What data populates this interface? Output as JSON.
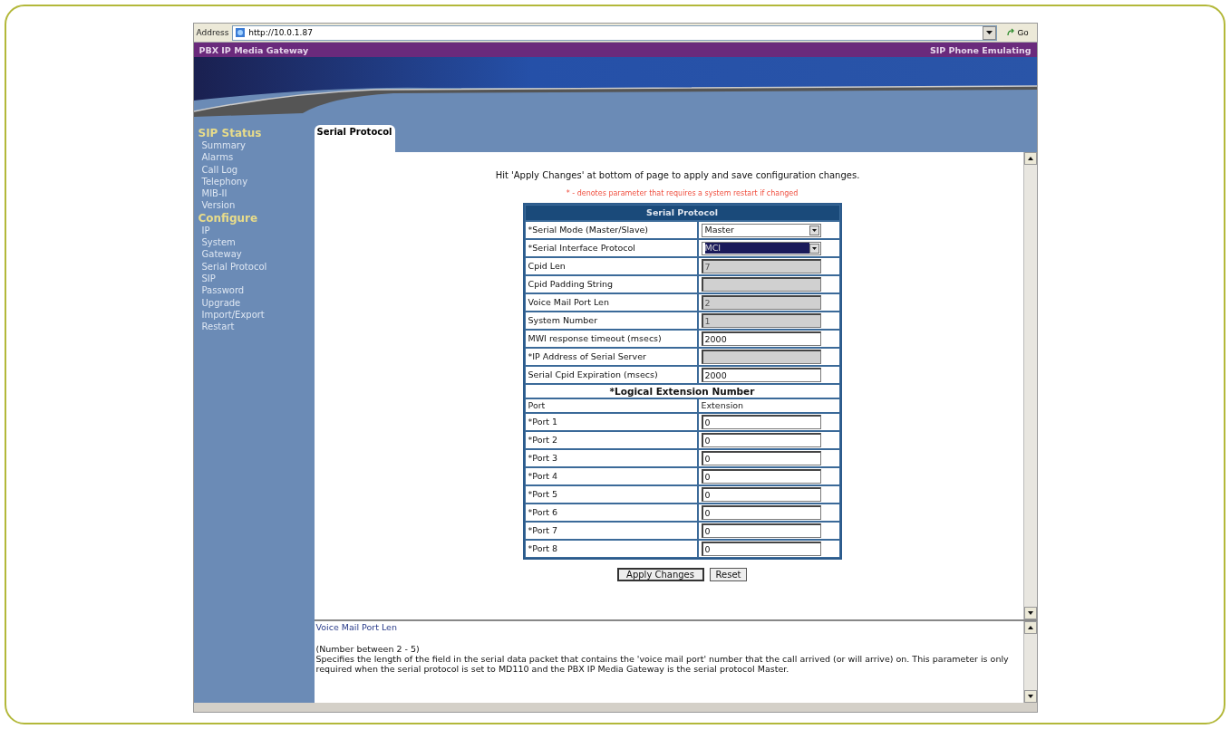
{
  "address_bar": {
    "label": "Address",
    "url": "http://10.0.1.87",
    "go": "Go"
  },
  "header": {
    "title": "PBX IP Media Gateway",
    "mode": "SIP Phone Emulating"
  },
  "sidebar": {
    "sections": [
      {
        "heading": "SIP Status",
        "items": [
          {
            "label": "Summary",
            "selected": false
          },
          {
            "label": "Alarms",
            "selected": false
          },
          {
            "label": "Call Log",
            "selected": false
          },
          {
            "label": "Telephony",
            "selected": false
          },
          {
            "label": "MIB-II",
            "selected": false
          },
          {
            "label": "Version",
            "selected": false
          }
        ]
      },
      {
        "heading": "Configure",
        "items": [
          {
            "label": "IP",
            "selected": false
          },
          {
            "label": "System",
            "selected": false
          },
          {
            "label": "Gateway",
            "selected": false
          },
          {
            "label": "Serial Protocol",
            "selected": false
          },
          {
            "label": "SIP",
            "selected": false
          },
          {
            "label": "Password",
            "selected": false
          },
          {
            "label": "Upgrade",
            "selected": false
          },
          {
            "label": "Import/Export",
            "selected": false
          },
          {
            "label": "Restart",
            "selected": false
          }
        ]
      }
    ]
  },
  "tabs": [
    {
      "label": "Serial Protocol",
      "selected": true
    }
  ],
  "instructions": "Hit 'Apply Changes' at bottom of page to apply and save configuration changes.",
  "note": "* - denotes parameter that requires a system restart if changed",
  "form": {
    "title": "Serial Protocol",
    "rows": [
      {
        "kind": "select",
        "label": "*Serial Mode (Master/Slave)",
        "value": "Master",
        "focused": false
      },
      {
        "kind": "select",
        "label": "*Serial Interface Protocol",
        "value": "MCI",
        "focused": true
      },
      {
        "kind": "input",
        "label": "Cpid Len",
        "value": "7",
        "disabled": true
      },
      {
        "kind": "input",
        "label": "Cpid Padding String",
        "disabled": true
      },
      {
        "kind": "input",
        "label": "Voice Mail Port Len",
        "value": "2",
        "disabled": true
      },
      {
        "kind": "input",
        "label": "System Number",
        "value": "1",
        "disabled": true
      },
      {
        "kind": "input",
        "label": "MWI response timeout (msecs)",
        "value": "2000",
        "disabled": false
      },
      {
        "kind": "input",
        "label": "*IP Address of Serial Server",
        "disabled": true
      },
      {
        "kind": "input",
        "label": "Serial Cpid Expiration (msecs)",
        "value": "2000",
        "disabled": false
      }
    ],
    "section": "*Logical Extension Number",
    "columns": [
      "Port",
      "Extension"
    ],
    "ports": [
      {
        "label": "*Port 1",
        "value": "0"
      },
      {
        "label": "*Port 2",
        "value": "0"
      },
      {
        "label": "*Port 3",
        "value": "0"
      },
      {
        "label": "*Port 4",
        "value": "0"
      },
      {
        "label": "*Port 5",
        "value": "0"
      },
      {
        "label": "*Port 6",
        "value": "0"
      },
      {
        "label": "*Port 7",
        "value": "0"
      },
      {
        "label": "*Port 8",
        "value": "0"
      }
    ]
  },
  "buttons": [
    "Apply Changes",
    "Reset"
  ],
  "help": {
    "title": "Voice Mail Port Len",
    "range": "(Number between 2 - 5)",
    "text": "Specifies the length of the field in the serial data packet that contains the 'voice mail port' number that the call arrived (or will arrive) on. This parameter is only required when the serial protocol is set to MD110 and the PBX IP Media Gateway is the serial protocol Master."
  }
}
